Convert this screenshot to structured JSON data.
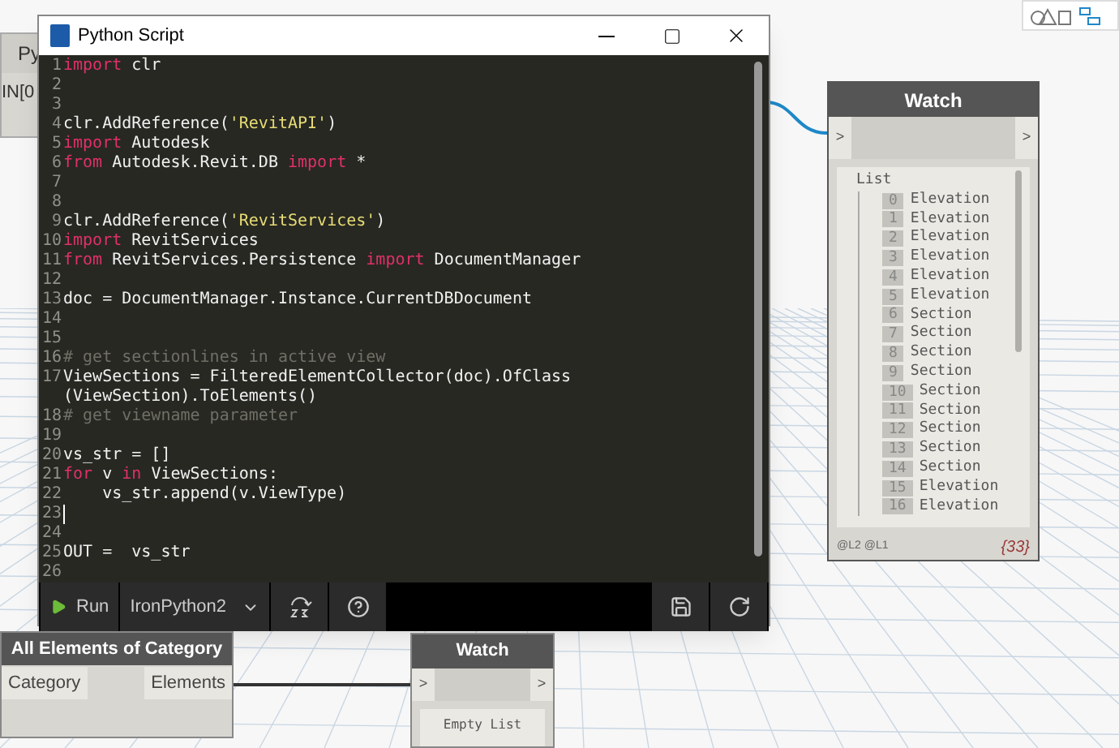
{
  "background_node": {
    "title": "Py",
    "port": "IN[0"
  },
  "editor": {
    "title": "Python Script",
    "lines": [
      {
        "number": "1",
        "segments": [
          {
            "text": "import",
            "kind": "keyword"
          },
          {
            "text": " clr",
            "kind": "plain"
          }
        ]
      },
      {
        "number": "2"
      },
      {
        "number": "3"
      },
      {
        "number": "4",
        "segments": [
          {
            "text": "clr.AddReference(",
            "kind": "plain"
          },
          {
            "text": "'RevitAPI'",
            "kind": "string"
          },
          {
            "text": ")",
            "kind": "plain"
          }
        ]
      },
      {
        "number": "5",
        "segments": [
          {
            "text": "import",
            "kind": "keyword"
          },
          {
            "text": " Autodesk",
            "kind": "plain"
          }
        ]
      },
      {
        "number": "6",
        "segments": [
          {
            "text": "from",
            "kind": "keyword"
          },
          {
            "text": " Autodesk.Revit.DB ",
            "kind": "plain"
          },
          {
            "text": "import",
            "kind": "keyword"
          },
          {
            "text": " *",
            "kind": "plain"
          }
        ]
      },
      {
        "number": "7"
      },
      {
        "number": "8"
      },
      {
        "number": "9",
        "segments": [
          {
            "text": "clr.AddReference(",
            "kind": "plain"
          },
          {
            "text": "'RevitServices'",
            "kind": "string"
          },
          {
            "text": ")",
            "kind": "plain"
          }
        ]
      },
      {
        "number": "10",
        "segments": [
          {
            "text": "import",
            "kind": "keyword"
          },
          {
            "text": " RevitServices",
            "kind": "plain"
          }
        ]
      },
      {
        "number": "11",
        "segments": [
          {
            "text": "from",
            "kind": "keyword"
          },
          {
            "text": " RevitServices.Persistence ",
            "kind": "plain"
          },
          {
            "text": "import",
            "kind": "keyword"
          },
          {
            "text": " DocumentManager",
            "kind": "plain"
          }
        ]
      },
      {
        "number": "12"
      },
      {
        "number": "13",
        "segments": [
          {
            "text": "doc = DocumentManager.Instance.CurrentDBDocument",
            "kind": "plain"
          }
        ]
      },
      {
        "number": "14"
      },
      {
        "number": "15"
      },
      {
        "number": "16",
        "segments": [
          {
            "text": "# get sectionlines in active view",
            "kind": "comment"
          }
        ]
      },
      {
        "number": "17",
        "segments": [
          {
            "text": "ViewSections = FilteredElementCollector(doc).OfClass",
            "kind": "plain"
          }
        ],
        "continuation": "(ViewSection).ToElements()"
      },
      {
        "number": "18",
        "segments": [
          {
            "text": "# get viewname parameter",
            "kind": "comment"
          }
        ]
      },
      {
        "number": "19"
      },
      {
        "number": "20",
        "segments": [
          {
            "text": "vs_str = []",
            "kind": "plain"
          }
        ]
      },
      {
        "number": "21",
        "segments": [
          {
            "text": "for",
            "kind": "keyword"
          },
          {
            "text": " v ",
            "kind": "plain"
          },
          {
            "text": "in",
            "kind": "keyword"
          },
          {
            "text": " ViewSections:",
            "kind": "plain"
          }
        ]
      },
      {
        "number": "22",
        "segments": [
          {
            "text": "    vs_str.append(v.ViewType)",
            "kind": "plain"
          }
        ]
      },
      {
        "number": "23",
        "cursor": true
      },
      {
        "number": "24"
      },
      {
        "number": "25",
        "segments": [
          {
            "text": "OUT =  vs_str",
            "kind": "plain"
          }
        ]
      },
      {
        "number": "26"
      }
    ],
    "run_label": "Run",
    "engine": "IronPython2"
  },
  "watch": {
    "title": "Watch",
    "in_port": ">",
    "out_port": ">",
    "list_label": "List",
    "items": [
      {
        "index": "0",
        "value": "Elevation"
      },
      {
        "index": "1",
        "value": "Elevation"
      },
      {
        "index": "2",
        "value": "Elevation"
      },
      {
        "index": "3",
        "value": "Elevation"
      },
      {
        "index": "4",
        "value": "Elevation"
      },
      {
        "index": "5",
        "value": "Elevation"
      },
      {
        "index": "6",
        "value": "Section"
      },
      {
        "index": "7",
        "value": "Section"
      },
      {
        "index": "8",
        "value": "Section"
      },
      {
        "index": "9",
        "value": "Section"
      },
      {
        "index": "10",
        "value": "Section"
      },
      {
        "index": "11",
        "value": "Section"
      },
      {
        "index": "12",
        "value": "Section"
      },
      {
        "index": "13",
        "value": "Section"
      },
      {
        "index": "14",
        "value": "Section"
      },
      {
        "index": "15",
        "value": "Elevation"
      },
      {
        "index": "16",
        "value": "Elevation"
      }
    ],
    "levels": "@L2 @L1",
    "count": "{33}"
  },
  "category_node": {
    "title": "All Elements of Category",
    "input": "Category",
    "output": "Elements"
  },
  "watch_small": {
    "title": "Watch",
    "in_port": ">",
    "out_port": ">",
    "value": "Empty List"
  }
}
